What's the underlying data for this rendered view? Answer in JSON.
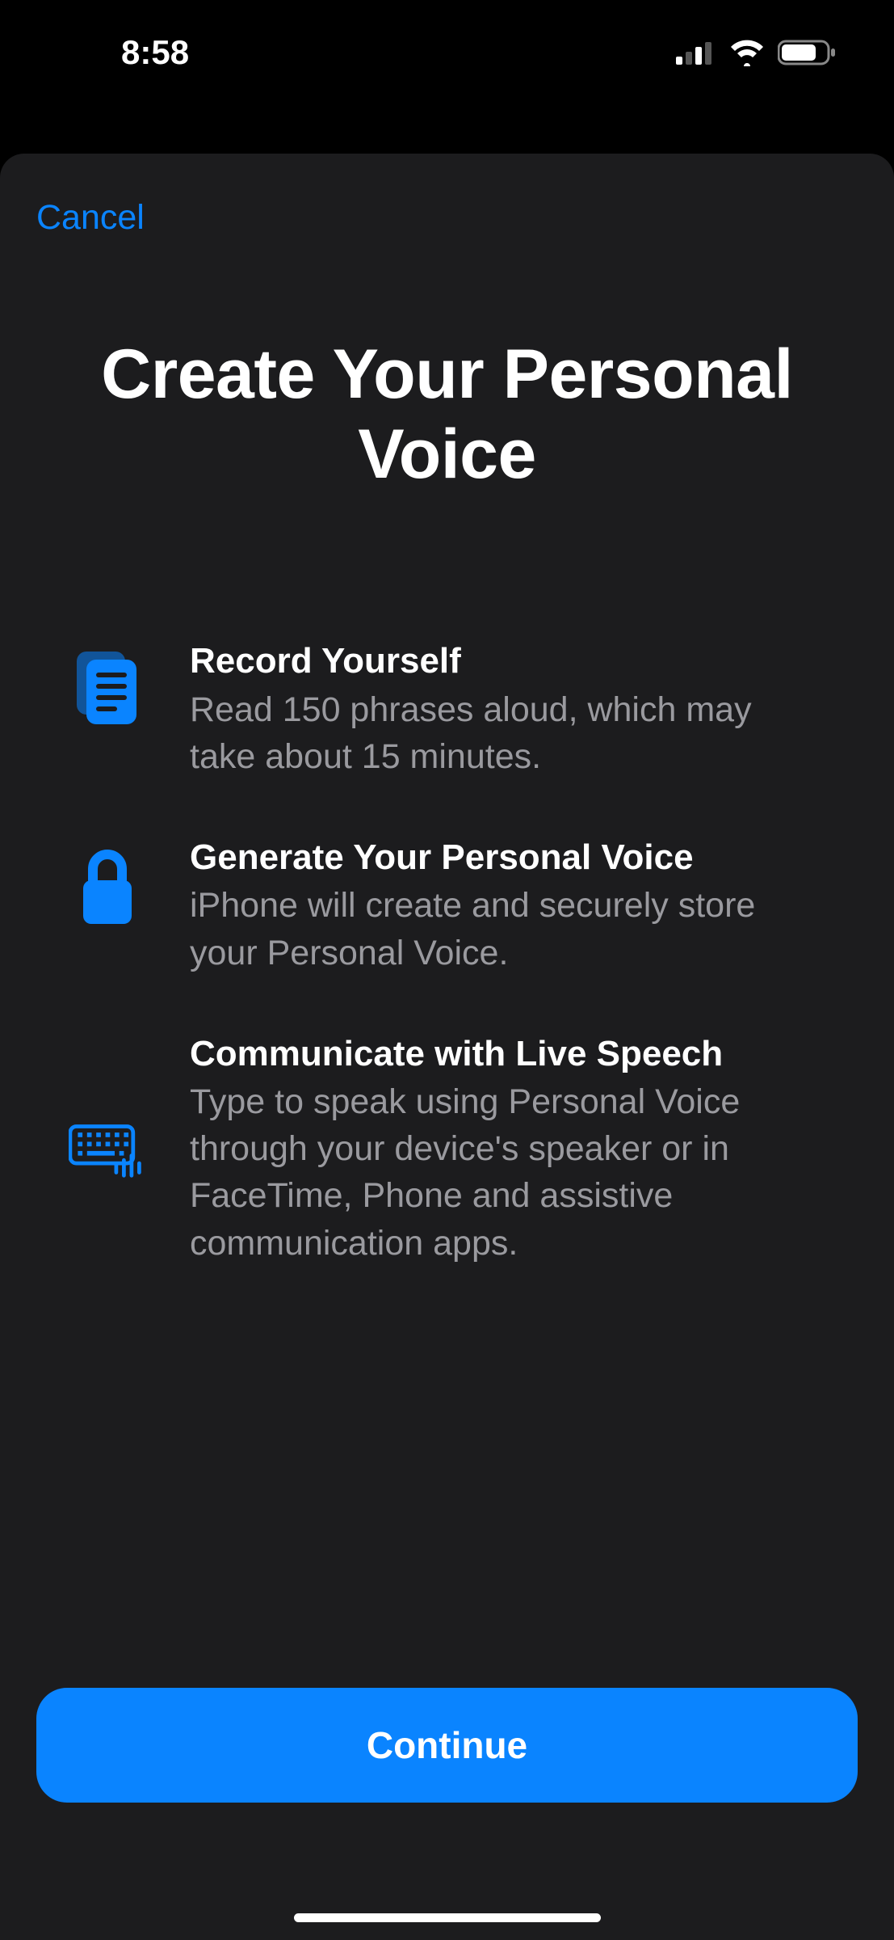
{
  "status": {
    "time": "8:58"
  },
  "modal": {
    "cancel": "Cancel",
    "title": "Create Your Personal Voice",
    "features": [
      {
        "title": "Record Yourself",
        "desc": "Read 150 phrases aloud, which may take about 15 minutes."
      },
      {
        "title": "Generate Your Personal Voice",
        "desc": "iPhone will create and securely store your Personal Voice."
      },
      {
        "title": "Communicate with Live Speech",
        "desc": "Type to speak using Personal Voice through your device's speaker or in FaceTime, Phone and assistive communication apps."
      }
    ],
    "continue": "Continue"
  },
  "colors": {
    "accent": "#0a84ff",
    "sheetBg": "#1c1c1e",
    "secondaryText": "#9a9a9f"
  }
}
